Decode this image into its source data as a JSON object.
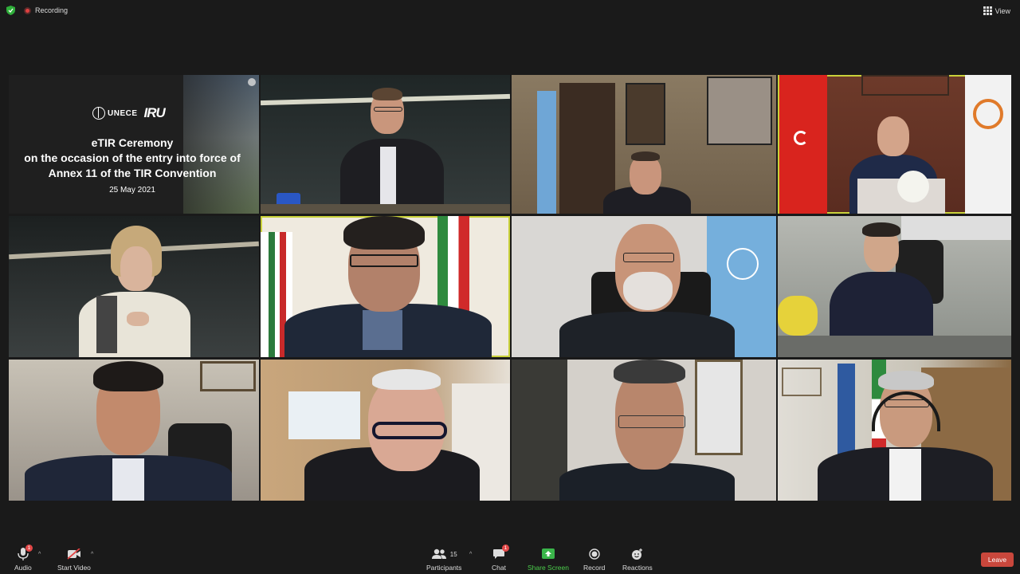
{
  "topbar": {
    "recording_label": "Recording",
    "view_label": "View"
  },
  "slide": {
    "un_text": "UNECE",
    "iru_text": "IRU",
    "title_line1": "eTIR Ceremony",
    "title_line2": "on the occasion of the entry into force of",
    "title_line3": "Annex 11 of the TIR Convention",
    "date": "25 May 2021"
  },
  "toolbar": {
    "audio_label": "Audio",
    "audio_badge": "1",
    "video_label": "Start Video",
    "participants_label": "Participants",
    "participants_count": "15",
    "chat_label": "Chat",
    "chat_badge": "1",
    "share_label": "Share Screen",
    "record_label": "Record",
    "reactions_label": "Reactions",
    "leave_label": "Leave"
  },
  "colors": {
    "active_speaker": "#c9d13a",
    "share_green": "#4ccf4c",
    "leave_red": "#c9473c"
  }
}
